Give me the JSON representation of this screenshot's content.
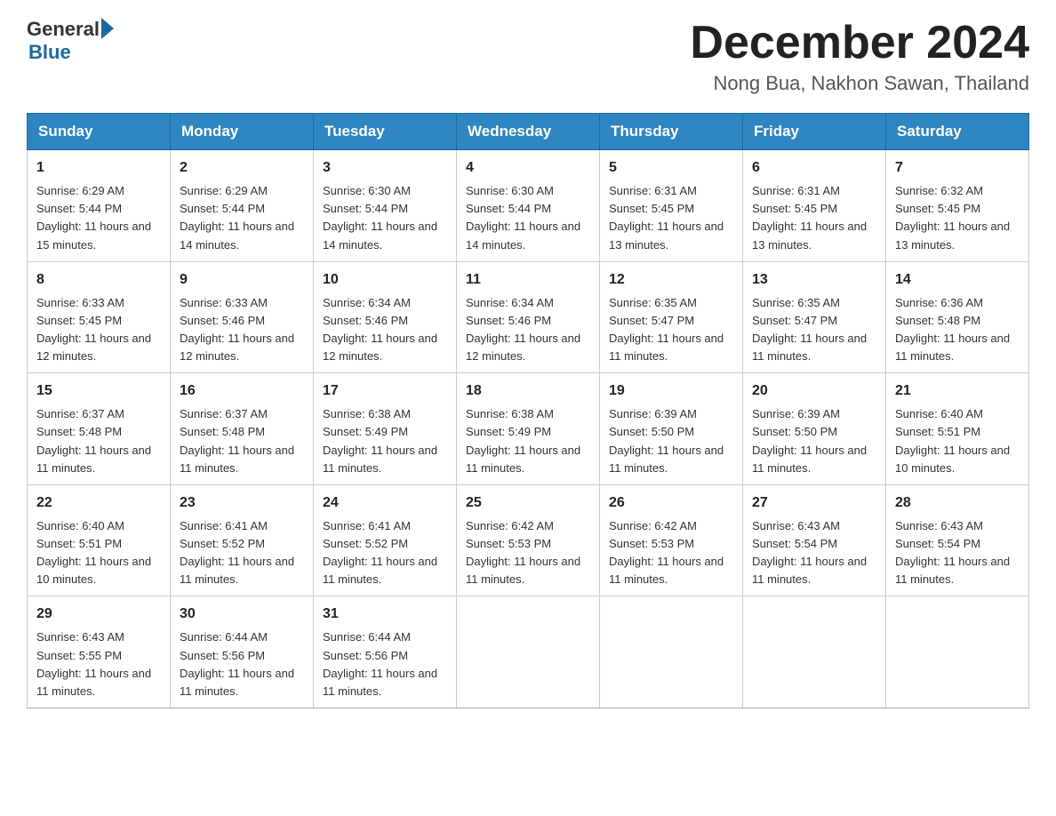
{
  "header": {
    "logo_general": "General",
    "logo_blue": "Blue",
    "title": "December 2024",
    "subtitle": "Nong Bua, Nakhon Sawan, Thailand"
  },
  "weekdays": [
    "Sunday",
    "Monday",
    "Tuesday",
    "Wednesday",
    "Thursday",
    "Friday",
    "Saturday"
  ],
  "weeks": [
    [
      {
        "day": "1",
        "sunrise": "6:29 AM",
        "sunset": "5:44 PM",
        "daylight": "11 hours and 15 minutes."
      },
      {
        "day": "2",
        "sunrise": "6:29 AM",
        "sunset": "5:44 PM",
        "daylight": "11 hours and 14 minutes."
      },
      {
        "day": "3",
        "sunrise": "6:30 AM",
        "sunset": "5:44 PM",
        "daylight": "11 hours and 14 minutes."
      },
      {
        "day": "4",
        "sunrise": "6:30 AM",
        "sunset": "5:44 PM",
        "daylight": "11 hours and 14 minutes."
      },
      {
        "day": "5",
        "sunrise": "6:31 AM",
        "sunset": "5:45 PM",
        "daylight": "11 hours and 13 minutes."
      },
      {
        "day": "6",
        "sunrise": "6:31 AM",
        "sunset": "5:45 PM",
        "daylight": "11 hours and 13 minutes."
      },
      {
        "day": "7",
        "sunrise": "6:32 AM",
        "sunset": "5:45 PM",
        "daylight": "11 hours and 13 minutes."
      }
    ],
    [
      {
        "day": "8",
        "sunrise": "6:33 AM",
        "sunset": "5:45 PM",
        "daylight": "11 hours and 12 minutes."
      },
      {
        "day": "9",
        "sunrise": "6:33 AM",
        "sunset": "5:46 PM",
        "daylight": "11 hours and 12 minutes."
      },
      {
        "day": "10",
        "sunrise": "6:34 AM",
        "sunset": "5:46 PM",
        "daylight": "11 hours and 12 minutes."
      },
      {
        "day": "11",
        "sunrise": "6:34 AM",
        "sunset": "5:46 PM",
        "daylight": "11 hours and 12 minutes."
      },
      {
        "day": "12",
        "sunrise": "6:35 AM",
        "sunset": "5:47 PM",
        "daylight": "11 hours and 11 minutes."
      },
      {
        "day": "13",
        "sunrise": "6:35 AM",
        "sunset": "5:47 PM",
        "daylight": "11 hours and 11 minutes."
      },
      {
        "day": "14",
        "sunrise": "6:36 AM",
        "sunset": "5:48 PM",
        "daylight": "11 hours and 11 minutes."
      }
    ],
    [
      {
        "day": "15",
        "sunrise": "6:37 AM",
        "sunset": "5:48 PM",
        "daylight": "11 hours and 11 minutes."
      },
      {
        "day": "16",
        "sunrise": "6:37 AM",
        "sunset": "5:48 PM",
        "daylight": "11 hours and 11 minutes."
      },
      {
        "day": "17",
        "sunrise": "6:38 AM",
        "sunset": "5:49 PM",
        "daylight": "11 hours and 11 minutes."
      },
      {
        "day": "18",
        "sunrise": "6:38 AM",
        "sunset": "5:49 PM",
        "daylight": "11 hours and 11 minutes."
      },
      {
        "day": "19",
        "sunrise": "6:39 AM",
        "sunset": "5:50 PM",
        "daylight": "11 hours and 11 minutes."
      },
      {
        "day": "20",
        "sunrise": "6:39 AM",
        "sunset": "5:50 PM",
        "daylight": "11 hours and 11 minutes."
      },
      {
        "day": "21",
        "sunrise": "6:40 AM",
        "sunset": "5:51 PM",
        "daylight": "11 hours and 10 minutes."
      }
    ],
    [
      {
        "day": "22",
        "sunrise": "6:40 AM",
        "sunset": "5:51 PM",
        "daylight": "11 hours and 10 minutes."
      },
      {
        "day": "23",
        "sunrise": "6:41 AM",
        "sunset": "5:52 PM",
        "daylight": "11 hours and 11 minutes."
      },
      {
        "day": "24",
        "sunrise": "6:41 AM",
        "sunset": "5:52 PM",
        "daylight": "11 hours and 11 minutes."
      },
      {
        "day": "25",
        "sunrise": "6:42 AM",
        "sunset": "5:53 PM",
        "daylight": "11 hours and 11 minutes."
      },
      {
        "day": "26",
        "sunrise": "6:42 AM",
        "sunset": "5:53 PM",
        "daylight": "11 hours and 11 minutes."
      },
      {
        "day": "27",
        "sunrise": "6:43 AM",
        "sunset": "5:54 PM",
        "daylight": "11 hours and 11 minutes."
      },
      {
        "day": "28",
        "sunrise": "6:43 AM",
        "sunset": "5:54 PM",
        "daylight": "11 hours and 11 minutes."
      }
    ],
    [
      {
        "day": "29",
        "sunrise": "6:43 AM",
        "sunset": "5:55 PM",
        "daylight": "11 hours and 11 minutes."
      },
      {
        "day": "30",
        "sunrise": "6:44 AM",
        "sunset": "5:56 PM",
        "daylight": "11 hours and 11 minutes."
      },
      {
        "day": "31",
        "sunrise": "6:44 AM",
        "sunset": "5:56 PM",
        "daylight": "11 hours and 11 minutes."
      },
      null,
      null,
      null,
      null
    ]
  ]
}
